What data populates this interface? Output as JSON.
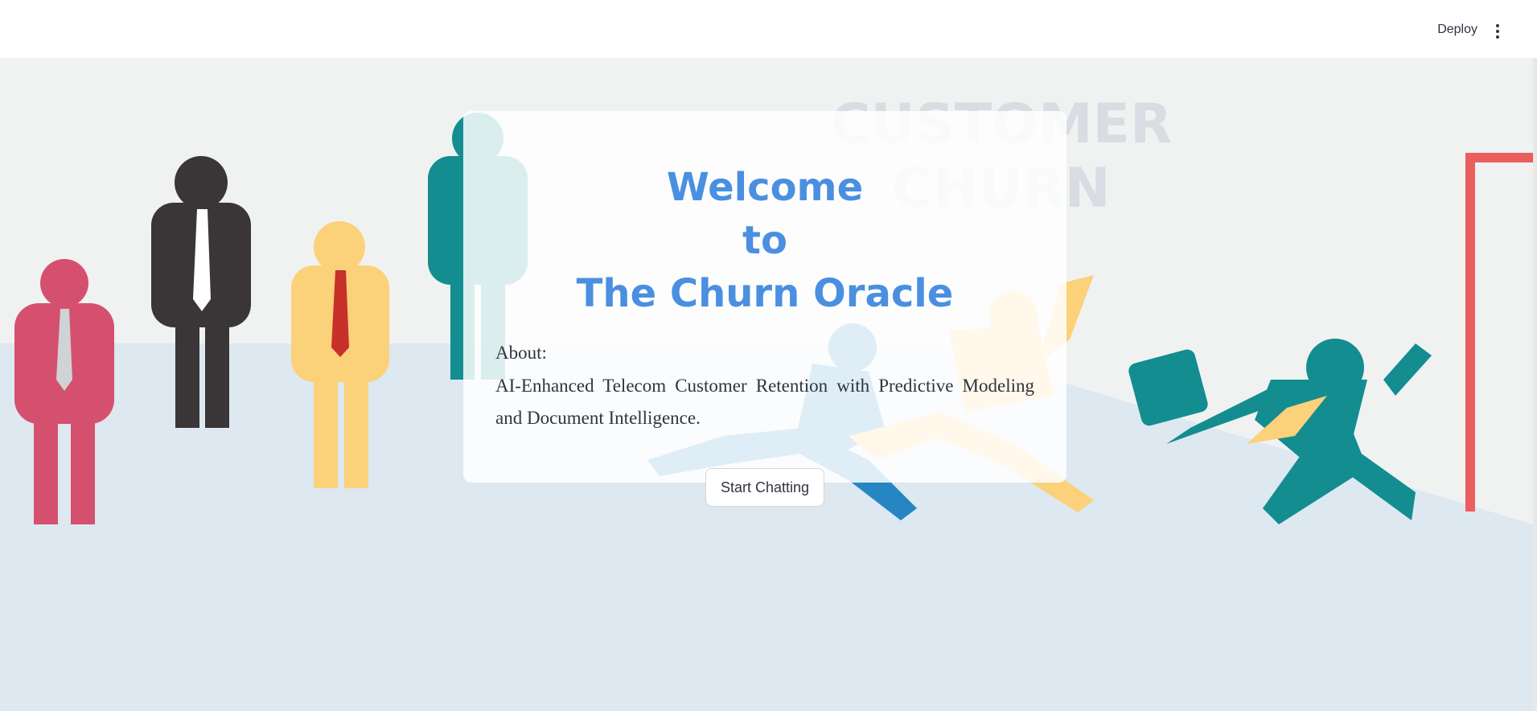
{
  "header": {
    "deploy_label": "Deploy",
    "menu_icon": "vertical-ellipsis-icon"
  },
  "background": {
    "poster_line1": "CUSTOMER",
    "poster_line2": "CHURN",
    "colors": {
      "wall": "#f0f2f2",
      "floor": "#dde8f0",
      "teal": "#138d90",
      "yellow": "#fbd17a",
      "pink": "#d5506f",
      "dark": "#3a3637",
      "blue": "#2686c4",
      "door": "#eb5e5e"
    }
  },
  "card": {
    "title_line1": "Welcome",
    "title_line2": "to",
    "title_line3": "The Churn Oracle",
    "about_label": "About:",
    "about_text": "AI-Enhanced Telecom Customer Retention with Predictive Modeling and Document Intelligence."
  },
  "actions": {
    "start_label": "Start Chatting"
  },
  "theme": {
    "title_color": "#4a8fe0",
    "text_color": "#31333f"
  }
}
